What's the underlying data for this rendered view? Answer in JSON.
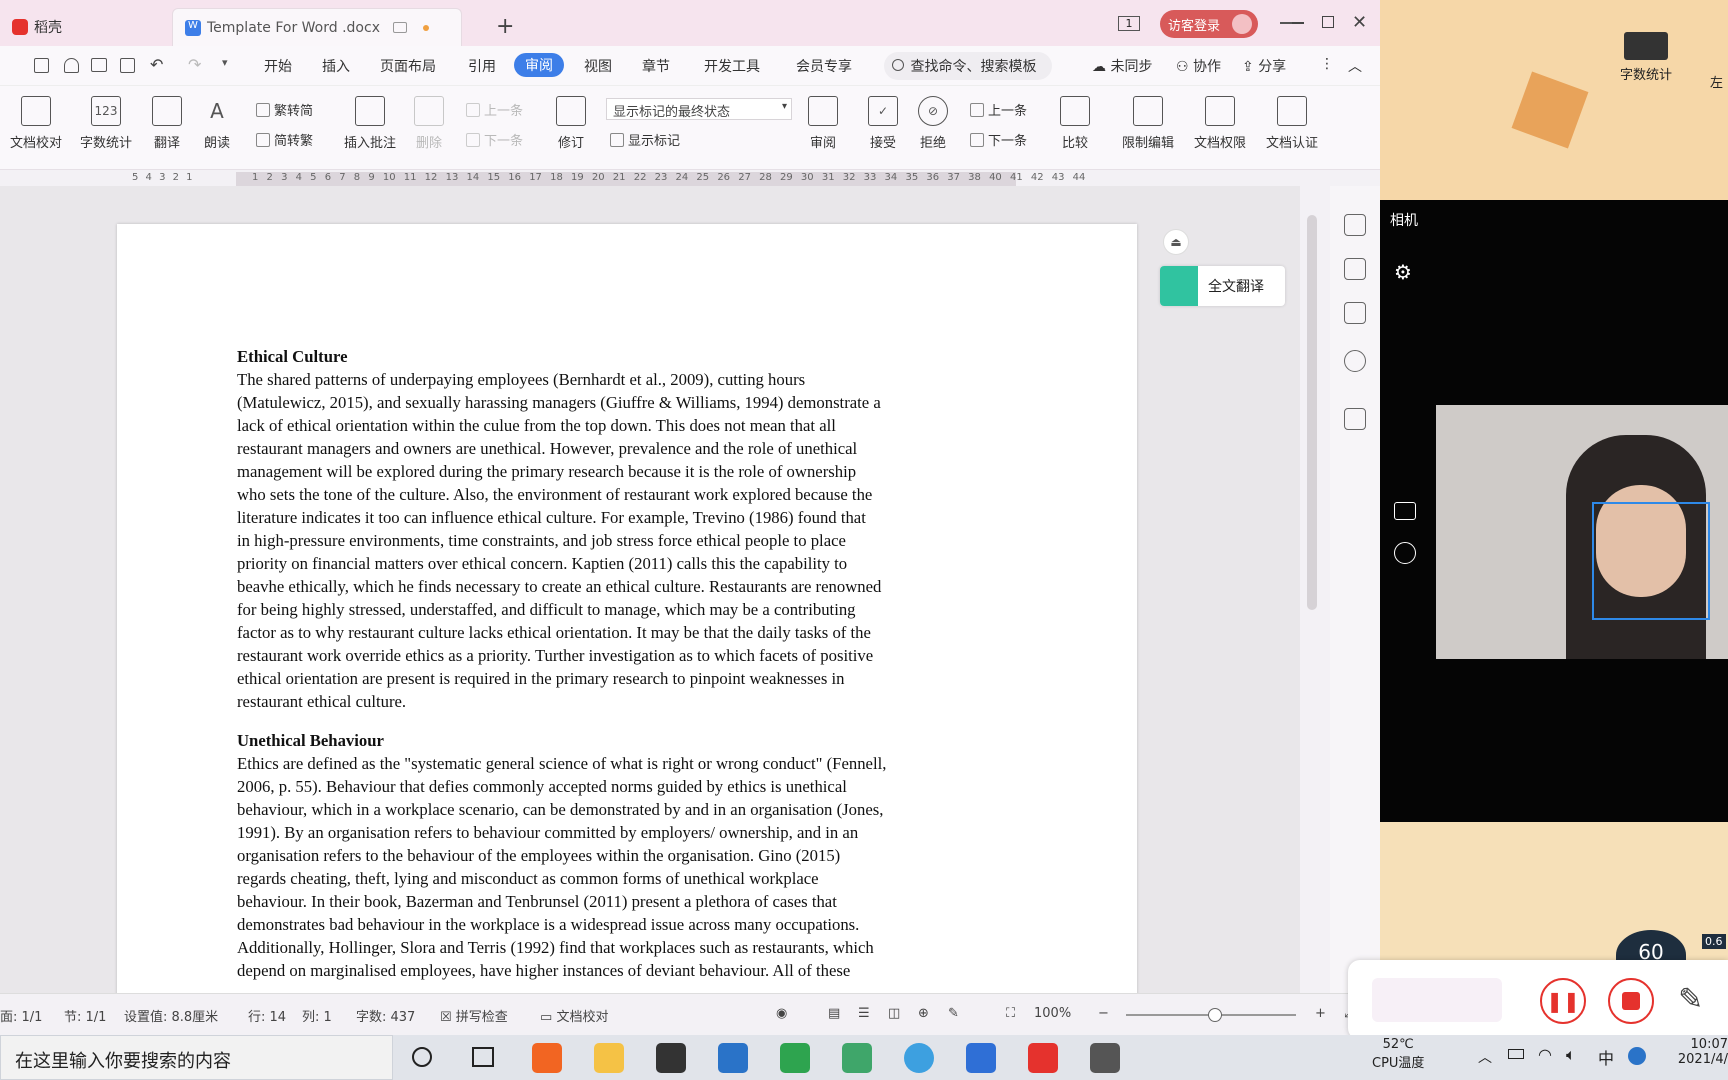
{
  "titlebar": {
    "home_tab": "稻壳",
    "doc_tab": "Template For Word .docx",
    "add_tab": "+",
    "login_button": "访客登录",
    "page_indicator": "1"
  },
  "menu": {
    "items": [
      "开始",
      "插入",
      "页面布局",
      "引用",
      "审阅",
      "视图",
      "章节",
      "开发工具",
      "会员专享"
    ],
    "active": "审阅",
    "search_placeholder": "查找命令、搜索模板",
    "sync": "未同步",
    "collab": "协作",
    "share": "分享"
  },
  "ribbon": {
    "doc_check": "文档校对",
    "word_count": "字数统计",
    "translate": "翻译",
    "read_aloud": "朗读",
    "trad_to_simp": "繁转简",
    "simp_to_trad": "简转繁",
    "insert_comment": "插入批注",
    "delete": "删除",
    "prev_comment": "上一条",
    "next_comment": "下一条",
    "track_changes": "修订",
    "display_dropdown": "显示标记的最终状态",
    "show_markup": "显示标记",
    "review": "审阅",
    "accept": "接受",
    "reject": "拒绝",
    "prev_change": "上一条",
    "next_change": "下一条",
    "compare": "比较",
    "restrict_edit": "限制编辑",
    "doc_permission": "文档权限",
    "doc_cert": "文档认证",
    "icon_123": "123"
  },
  "ruler": {
    "left_ticks": [
      "5",
      "4",
      "3",
      "2",
      "1"
    ],
    "ticks": [
      "1",
      "2",
      "3",
      "4",
      "5",
      "6",
      "7",
      "8",
      "9",
      "10",
      "11",
      "12",
      "13",
      "14",
      "15",
      "16",
      "17",
      "18",
      "19",
      "20",
      "21",
      "22",
      "23",
      "24",
      "25",
      "26",
      "27",
      "28",
      "29",
      "30",
      "31",
      "32",
      "33",
      "34",
      "35",
      "36",
      "37",
      "38",
      "40",
      "41",
      "42",
      "43",
      "44"
    ]
  },
  "translate_panel": {
    "label": "全文翻译"
  },
  "document": {
    "heading1": "Ethical Culture",
    "para1": "The shared patterns of underpaying employees (Bernhardt et al., 2009), cutting hours\n(Matulewicz, 2015), and sexually harassing managers (Giuffre & Williams, 1994) demonstrate a\nlack of ethical orientation within the culue from the top down.  This does not mean that all\nrestaurant managers and owners are unethical.  However, prevalence and the role of unethical\nmanagement will be explored during the primary research because it is the role of ownership\nwho sets the tone of the culture.  Also, the environment of restaurant work explored because the\nliterature indicates it too can influence ethical culture.  For example, Trevino (1986) found that\nin high-pressure environments, time constraints, and job stress force ethical people to place\npriority on financial matters over ethical concern.  Kaptien (2011) calls this the capability to\nbeavhe ethically, which he finds necessary to create an ethical culture.  Restaurants are renowned\nfor being highly stressed, understaffed, and difficult to manage, which may be a contributing\nfactor as to why restaurant culture lacks ethical orientation.  It may be that the daily tasks of the\nrestaurant work override ethics as a priority.  Turther investigation as to which facets of positive\nethical orientation are present is required in the primary research to pinpoint weaknesses in\nrestaurant ethical culture.",
    "heading2": "Unethical Behaviour",
    "para2": "Ethics are defined as the \"systematic general science of what is right or wrong conduct\" (Fennell,\n2006, p. 55).  Behaviour that defies commonly accepted norms guided by ethics is unethical\nbehaviour, which in a workplace scenario, can be demonstrated by and in an organisation (Jones,\n1991).  By an organisation refers to behaviour committed by employers/ ownership, and in an\norganisation refers to the behaviour of the employees within the organisation.  Gino (2015)\nregards cheating, theft, lying and misconduct as common forms of unethical workplace\nbehaviour.  In their book, Bazerman and Tenbrunsel (2011) present a plethora of cases that\ndemonstrates bad behaviour in the workplace is a widespread issue across many occupations.\nAdditionally, Hollinger, Slora and Terris (1992) find that workplaces such as restaurants, which\ndepend on marginalised employees, have higher instances of deviant behaviour.  All of these"
  },
  "statusbar": {
    "page": "面: 1/1",
    "section": "节: 1/1",
    "setting": "设置值: 8.8厘米",
    "row": "行: 14",
    "col": "列: 1",
    "words": "字数: 437",
    "spellcheck": "拼写检查",
    "doccheck": "文档校对",
    "zoom": "100%"
  },
  "taskbar": {
    "search_placeholder": "在这里输入你要搜索的内容",
    "cpu_temp": "52℃",
    "cpu_label": "CPU温度",
    "time": "10:07",
    "date": "2021/4/",
    "ime": "中"
  },
  "side_panel": {
    "camera_title": "相机",
    "word_count_tile": "字数统计",
    "left_label": "左",
    "timer": "60",
    "timer_value": "0.6"
  },
  "colors": {
    "accent": "#3d7ee8",
    "titlebar": "#f6e4ee",
    "login_button": "#d85a5a",
    "record_red": "#e5322d",
    "face_box": "#2e89e8"
  }
}
